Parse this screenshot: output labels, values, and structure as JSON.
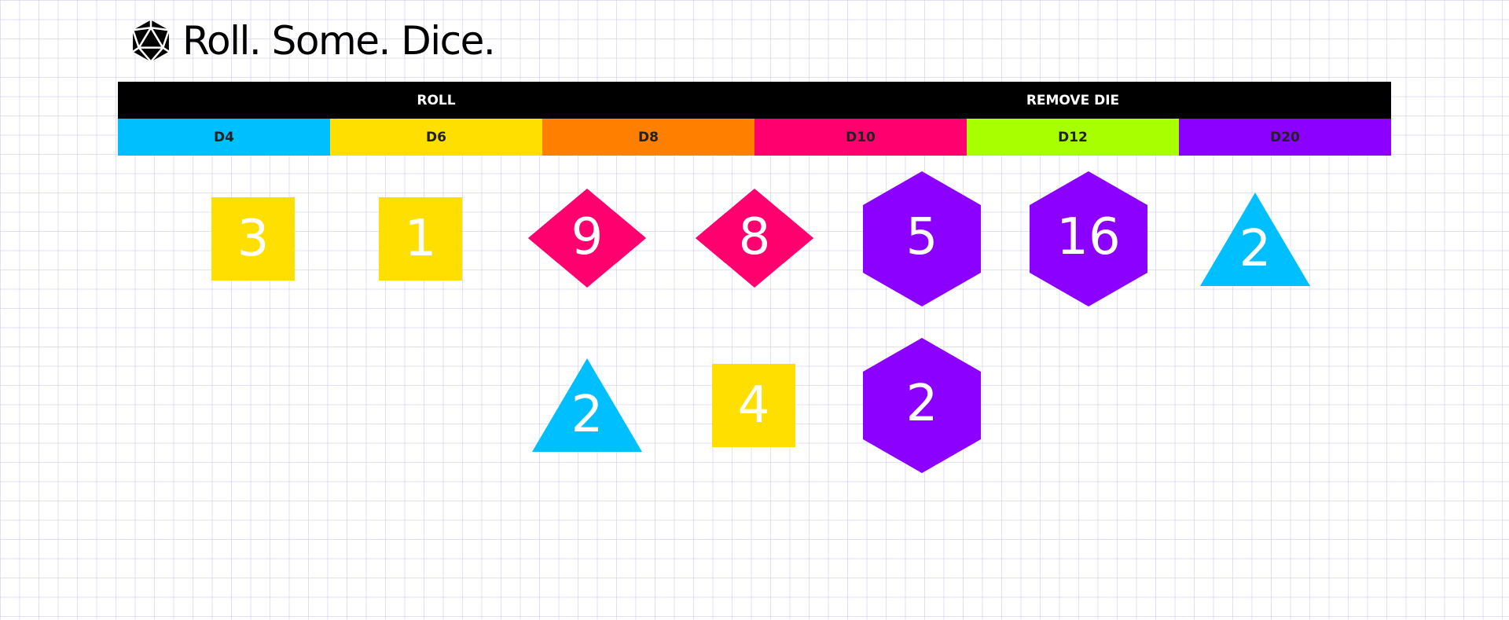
{
  "app": {
    "title": "Roll. Some. Dice.",
    "logo_icon": "d20-icon"
  },
  "actions": {
    "roll_label": "ROLL",
    "remove_label": "REMOVE DIE"
  },
  "dice_types": [
    {
      "label": "D4",
      "color": "#00BFFF"
    },
    {
      "label": "D6",
      "color": "#FFDF00"
    },
    {
      "label": "D8",
      "color": "#FF7F00"
    },
    {
      "label": "D10",
      "color": "#FF006E"
    },
    {
      "label": "D12",
      "color": "#A8FF00"
    },
    {
      "label": "D20",
      "color": "#8C00FF"
    }
  ],
  "rolled_dice": [
    {
      "type": "d6",
      "value": "3"
    },
    {
      "type": "d6",
      "value": "1"
    },
    {
      "type": "d10",
      "value": "9"
    },
    {
      "type": "d10",
      "value": "8"
    },
    {
      "type": "d20",
      "value": "5"
    },
    {
      "type": "d20",
      "value": "16"
    },
    {
      "type": "d4",
      "value": "2"
    },
    {
      "type": "d4",
      "value": "2"
    },
    {
      "type": "d6",
      "value": "4"
    },
    {
      "type": "d20",
      "value": "2"
    }
  ]
}
